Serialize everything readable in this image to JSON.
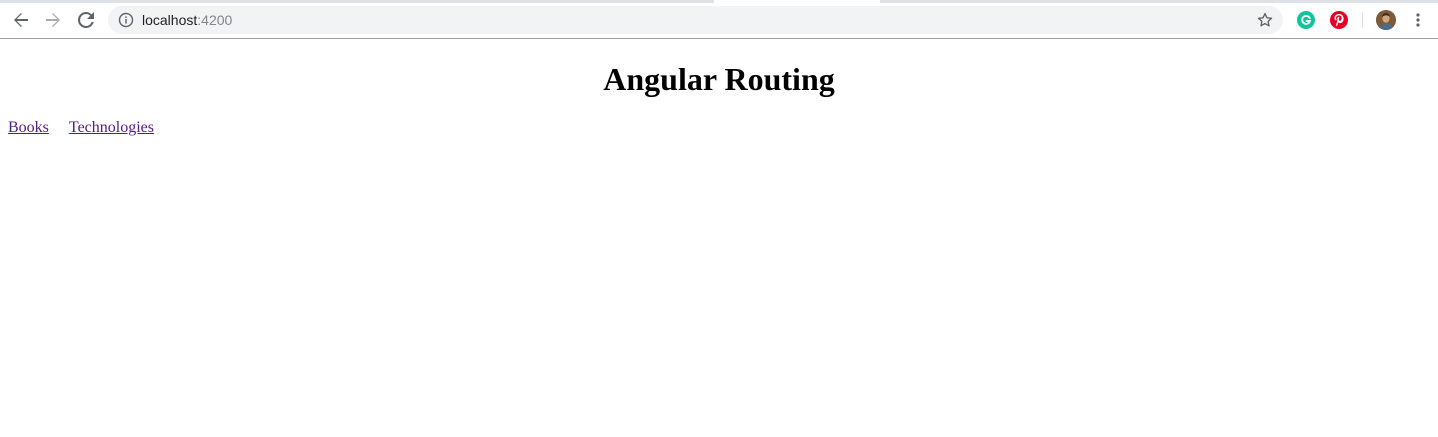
{
  "browser": {
    "url_host": "localhost",
    "url_port": ":4200",
    "icons": {
      "back": "arrow-left-icon",
      "forward": "arrow-right-icon",
      "reload": "reload-icon",
      "site_info": "info-icon",
      "bookmark": "star-icon",
      "grammarly": "grammarly-icon",
      "pinterest": "pinterest-icon",
      "profile": "avatar-icon",
      "menu": "kebab-menu-icon"
    },
    "colors": {
      "omnibox_bg": "#f1f3f4",
      "grammarly": "#15c39a",
      "pinterest": "#e60023",
      "visited_link": "#551a8b"
    }
  },
  "page": {
    "title": "Angular Routing",
    "nav_links": [
      {
        "label": "Books"
      },
      {
        "label": "Technologies"
      }
    ]
  }
}
